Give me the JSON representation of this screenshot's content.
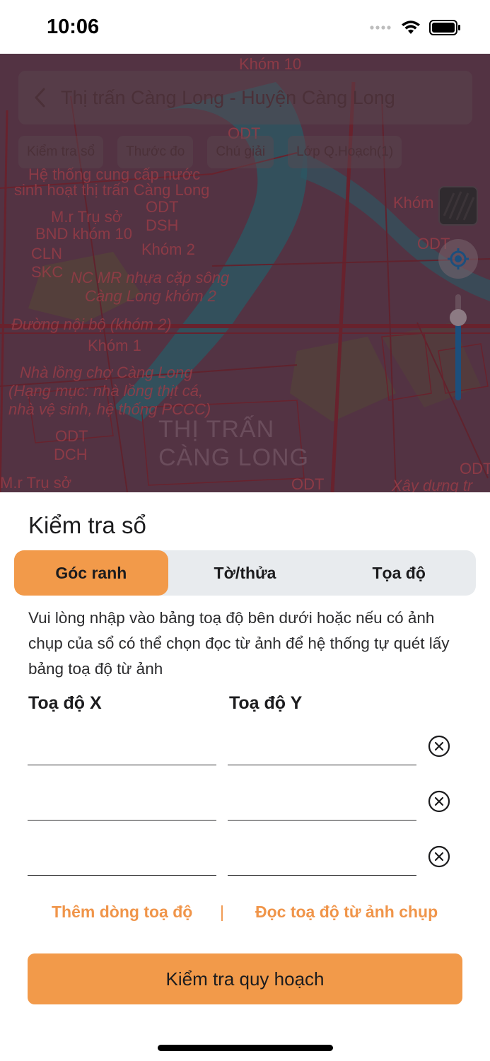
{
  "status_bar": {
    "time": "10:06"
  },
  "map": {
    "title": "Thị trấn Càng Long - Huyện Càng Long",
    "chips": [
      "Kiểm tra sổ",
      "Thước đo",
      "Chú giải",
      "Lớp Q.Hoạch(1)"
    ],
    "labels": {
      "khom_10": "Khóm 10",
      "odt_top": "ODT",
      "he_thong_1": "Hệ thống cung cấp nước",
      "he_thong_2": "sinh hoạt thị trấn Càng Long",
      "tru_so_1": "M.r Trụ sở",
      "tru_so_2": "BND khóm 10",
      "odt_1": "ODT",
      "dsh": "DSH",
      "cln": "CLN",
      "skc": "SKC",
      "khom_2": "Khóm 2",
      "nc_mr_1": "NC MR nhựa cặp sông",
      "nc_mr_2": "Càng Long khóm 2",
      "duong_noi_bo": "Đường nội bộ (khóm 2)",
      "khom_1": "Khóm 1",
      "nha_long_1": "Nhà lồng chợ Càng Long",
      "nha_long_2": "(Hạng mục: nhà lồng thịt cá,",
      "nha_long_3": "nhà vệ sinh, hệ thống PCCC)",
      "odt_2": "ODT",
      "dch": "DCH",
      "thi_tran_1": "THỊ TRẤN",
      "thi_tran_2": "CÀNG LONG",
      "tru_so_bottom": "M.r Trụ sở",
      "khom_right": "Khóm",
      "odt_right": "ODT",
      "odt_bottom_right": "ODT",
      "odt_bottom": "ODT",
      "xay_dung": "Xây dựng tr"
    },
    "zoom_level": 0.78
  },
  "sheet": {
    "title": "Kiểm tra sổ",
    "tabs": [
      {
        "label": "Góc ranh",
        "active": true
      },
      {
        "label": "Tờ/thửa",
        "active": false
      },
      {
        "label": "Tọa độ",
        "active": false
      }
    ],
    "instructions": "Vui lòng nhập vào bảng toạ độ bên dưới hoặc nếu có ảnh chụp của sổ có thể chọn đọc từ ảnh để hệ thống tự quét lấy bảng toạ độ từ ảnh",
    "col_x_label": "Toạ độ X",
    "col_y_label": "Toạ độ Y",
    "rows": [
      {
        "x": "",
        "y": ""
      },
      {
        "x": "",
        "y": ""
      },
      {
        "x": "",
        "y": ""
      }
    ],
    "add_row_label": "Thêm dòng toạ độ",
    "divider": "|",
    "read_photo_label": "Đọc toạ độ từ ảnh chụp",
    "submit_label": "Kiểm tra quy hoạch"
  },
  "colors": {
    "accent": "#f29a4a",
    "accent_text": "#f0954a",
    "segment_bg": "#e8ebee"
  }
}
